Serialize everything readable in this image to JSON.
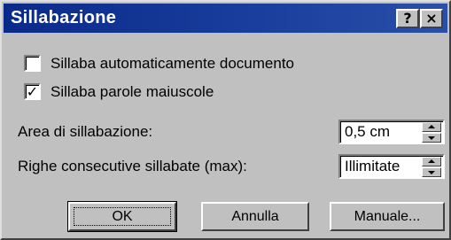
{
  "window": {
    "title": "Sillabazione",
    "help_label": "?",
    "close_label": "×"
  },
  "options": {
    "auto_hyphenate": {
      "label": "Sillaba automaticamente documento",
      "checked": false,
      "mark": ""
    },
    "hyphenate_caps": {
      "label": "Sillaba parole maiuscole",
      "checked": true,
      "mark": "✓"
    }
  },
  "zone": {
    "label": "Area di sillabazione:",
    "value": "0,5 cm"
  },
  "consecutive": {
    "label": "Righe consecutive sillabate (max):",
    "value": "Illimitate"
  },
  "buttons": {
    "ok": "OK",
    "cancel": "Annulla",
    "manual": "Manuale..."
  }
}
